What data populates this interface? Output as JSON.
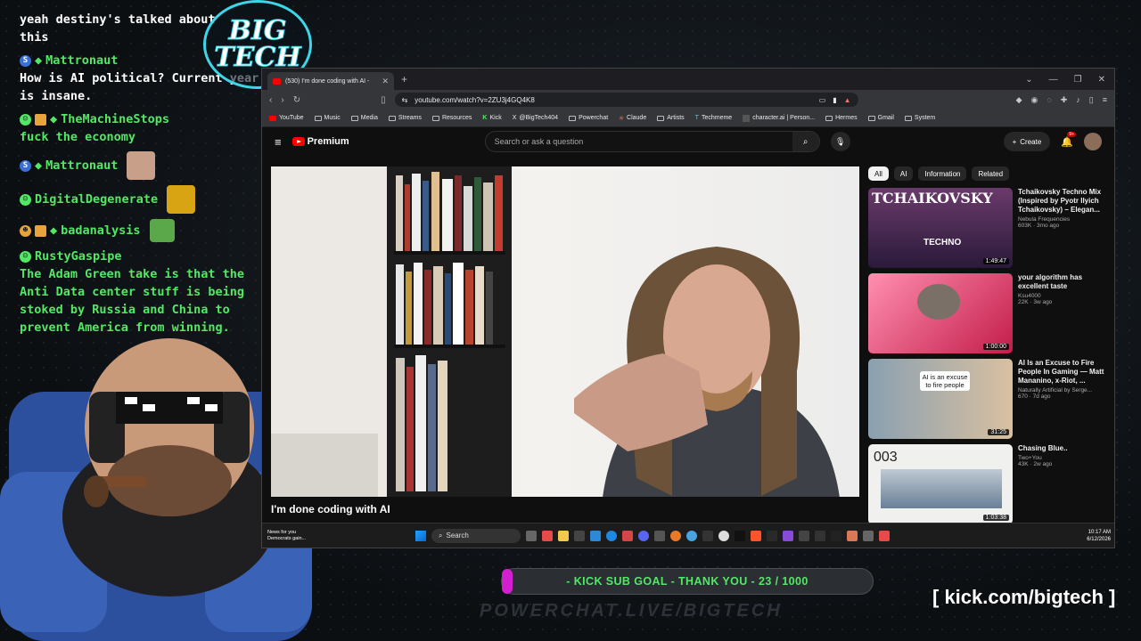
{
  "chat": {
    "pre_text": "yeah destiny's talked about",
    "pre_text2": "this",
    "messages": [
      {
        "user": "Mattronaut",
        "text": "How is AI political? Current year is insane."
      },
      {
        "user": "TheMachineStops",
        "text": "fuck the economy"
      },
      {
        "user": "Mattronaut",
        "text": ""
      },
      {
        "user": "DigitalDegenerate",
        "text": ""
      },
      {
        "user": "badanalysis",
        "text": ""
      },
      {
        "user": "RustyGaspipe",
        "text": "The Adam Green take is that the Anti Data center stuff is being stoked by Russia and China to prevent America from winning."
      }
    ]
  },
  "logo": {
    "line1": "BIG",
    "line2": "TECH"
  },
  "browser": {
    "tab_title": "(530) I'm done coding with AI -",
    "url": "youtube.com/watch?v=2ZU3j4GQ4K8",
    "bookmarks": [
      "YouTube",
      "Music",
      "Media",
      "Streams",
      "Resources",
      "Kick",
      "@BigTech404",
      "Powerchat",
      "Claude",
      "Artists",
      "Techmeme",
      "character.ai | Person...",
      "Hermes",
      "Gmail",
      "System"
    ]
  },
  "youtube": {
    "brand": "Premium",
    "search_placeholder": "Search or ask a question",
    "create_label": "Create",
    "notif_count": "9+",
    "video_title": "I'm done coding with AI",
    "chips": [
      "All",
      "AI",
      "Information",
      "Related"
    ],
    "recommendations": [
      {
        "title": "Tchaikovsky Techno Mix (Inspired by Pyotr Ilyich Tchaikovsky) – Elegan...",
        "channel": "Nebula Frequencies",
        "meta": "603K · 3mo ago",
        "duration": "1:49:47",
        "thumb_text": "TCHAIKOVSKY",
        "thumb_sub": "TECHNO"
      },
      {
        "title": "your algorithm has excellent taste",
        "channel": "Ksu4000",
        "meta": "22K · 3w ago",
        "duration": "1:00:00",
        "thumb_text": "",
        "thumb_sub": ""
      },
      {
        "title": "AI Is an Excuse to Fire People In Gaming — Matt Mananino, x-Riot, ...",
        "channel": "Naturally Artificial by Serge...",
        "meta": "670 · 7d ago",
        "duration": "31:25",
        "thumb_text": "AI is an excuse to fire people",
        "thumb_sub": ""
      },
      {
        "title": "Chasing Blue..",
        "channel": "Two+You",
        "meta": "43K · 2w ago",
        "duration": "1:03:38",
        "thumb_text": "003",
        "thumb_sub": ""
      }
    ]
  },
  "taskbar": {
    "news_line1": "News for you",
    "news_line2": "Democrats gain...",
    "search_label": "Search",
    "time": "10:17 AM",
    "date": "6/12/2026"
  },
  "overlay": {
    "goal_text": "- KICK SUB GOAL - THANK YOU - 23 / 1000",
    "goal_progress": 0.023,
    "kick_link": "[ kick.com/bigtech ]",
    "ghost_text": "POWERCHAT.LIVE/BIGTECH"
  },
  "colors": {
    "chat_user": "#52e865",
    "logo_ring": "#3dd6e8",
    "goal_fill": "#d21fd0",
    "yt_red": "#ff0000"
  }
}
